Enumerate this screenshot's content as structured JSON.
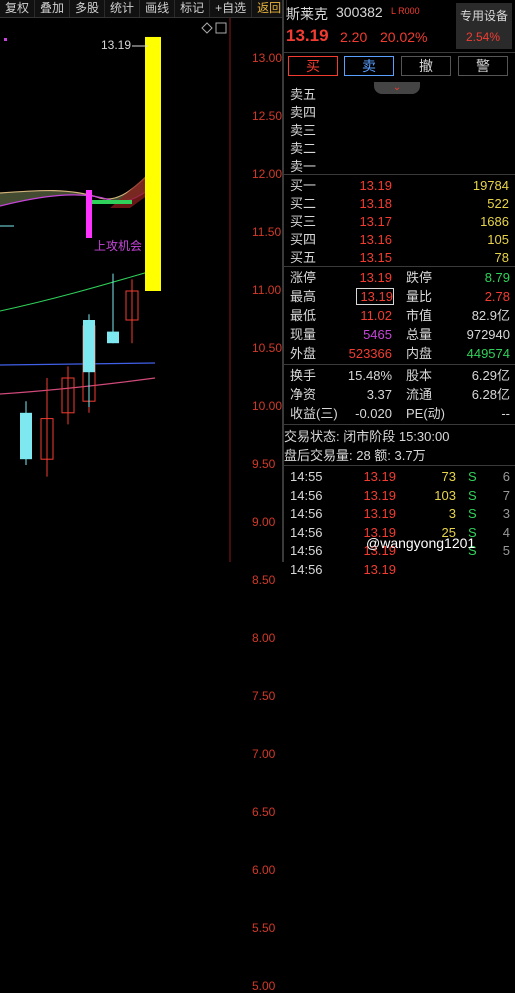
{
  "toolbar": {
    "buttons": [
      "复权",
      "叠加",
      "多股",
      "统计",
      "画线",
      "标记",
      "+自选",
      "返回"
    ]
  },
  "chart": {
    "price_labels": [
      "13.00",
      "12.50",
      "12.00",
      "11.50",
      "11.00",
      "10.50",
      "10.00",
      "9.50",
      "9.00",
      "8.50",
      "8.00",
      "7.50",
      "7.00",
      "6.50",
      "6.00",
      "5.50",
      "5.00"
    ],
    "high_label": "13.19",
    "annotation": "上攻机会",
    "candles": [
      {
        "o": 9.95,
        "c": 9.55,
        "h": 10.05,
        "l": 9.5,
        "dir": "down"
      },
      {
        "o": 9.55,
        "c": 9.9,
        "h": 10.25,
        "l": 9.4,
        "dir": "up"
      },
      {
        "o": 9.95,
        "c": 10.25,
        "h": 10.35,
        "l": 9.85,
        "dir": "up"
      },
      {
        "o": 10.05,
        "c": 10.7,
        "h": 10.75,
        "l": 9.95,
        "dir": "up"
      },
      {
        "o": 10.75,
        "c": 10.3,
        "h": 10.8,
        "l": 10.0,
        "dir": "down"
      },
      {
        "o": 10.55,
        "c": 10.65,
        "h": 11.15,
        "l": 10.55,
        "dir": "down"
      },
      {
        "o": 10.75,
        "c": 11.0,
        "h": 11.1,
        "l": 10.55,
        "dir": "up"
      },
      {
        "o": 11.0,
        "c": 13.19,
        "h": 13.19,
        "l": 11.0,
        "dir": "limit"
      }
    ]
  },
  "header": {
    "name": "斯莱克",
    "code": "300382",
    "tags": "L R000",
    "price": "13.19",
    "change": "2.20",
    "change_pct": "20.02%",
    "device_label": "专用设备",
    "device_pct": "2.54%",
    "buttons": [
      "买",
      "卖",
      "撤",
      "警"
    ]
  },
  "sell_orders": [
    {
      "label": "卖五",
      "price": "",
      "vol": ""
    },
    {
      "label": "卖四",
      "price": "",
      "vol": ""
    },
    {
      "label": "卖三",
      "price": "",
      "vol": ""
    },
    {
      "label": "卖二",
      "price": "",
      "vol": ""
    },
    {
      "label": "卖一",
      "price": "",
      "vol": ""
    }
  ],
  "buy_orders": [
    {
      "label": "买一",
      "price": "13.19",
      "vol": "19784"
    },
    {
      "label": "买二",
      "price": "13.18",
      "vol": "522"
    },
    {
      "label": "买三",
      "price": "13.17",
      "vol": "1686"
    },
    {
      "label": "买四",
      "price": "13.16",
      "vol": "105"
    },
    {
      "label": "买五",
      "price": "13.15",
      "vol": "78"
    }
  ],
  "stats": [
    {
      "l1": "涨停",
      "v1": "13.19",
      "c1": "red",
      "l2": "跌停",
      "v2": "8.79",
      "c2": "grn"
    },
    {
      "l1": "最高",
      "v1": "13.19",
      "c1": "red",
      "l2": "量比",
      "v2": "2.78",
      "c2": "red"
    },
    {
      "l1": "最低",
      "v1": "11.02",
      "c1": "red",
      "l2": "市值",
      "v2": "82.9亿",
      "c2": "wht"
    },
    {
      "l1": "现量",
      "v1": "5465",
      "c1": "pur",
      "l2": "总量",
      "v2": "972940",
      "c2": "wht"
    },
    {
      "l1": "外盘",
      "v1": "523366",
      "c1": "red",
      "l2": "内盘",
      "v2": "449574",
      "c2": "grn"
    }
  ],
  "stats2": [
    {
      "l1": "换手",
      "v1": "15.48%",
      "l2": "股本",
      "v2": "6.29亿"
    },
    {
      "l1": "净资",
      "v1": "3.37",
      "l2": "流通",
      "v2": "6.28亿"
    },
    {
      "l1": "收益(三)",
      "v1": "-0.020",
      "l2": "PE(动)",
      "v2": "--"
    }
  ],
  "trade_status": "交易状态: 闭市阶段 15:30:00",
  "after_hours": "盘后交易量: 28  额: 3.7万",
  "ticks": [
    {
      "time": "14:55",
      "price": "13.19",
      "vol": "73",
      "side": "S",
      "n": "6"
    },
    {
      "time": "14:56",
      "price": "13.19",
      "vol": "103",
      "side": "S",
      "n": "7"
    },
    {
      "time": "14:56",
      "price": "13.19",
      "vol": "3",
      "side": "S",
      "n": "3"
    },
    {
      "time": "14:56",
      "price": "13.19",
      "vol": "25",
      "side": "S",
      "n": "4"
    },
    {
      "time": "14:56",
      "price": "13.19",
      "vol": "",
      "side": "S",
      "n": "5"
    },
    {
      "time": "14:56",
      "price": "13.19",
      "vol": "",
      "side": "",
      "n": ""
    }
  ],
  "watermark": "@wangyong1201",
  "colors": {
    "up": "#f23c32",
    "down": "#2fd15a",
    "limit": "#ffff00",
    "accent": "#e8b43c"
  }
}
